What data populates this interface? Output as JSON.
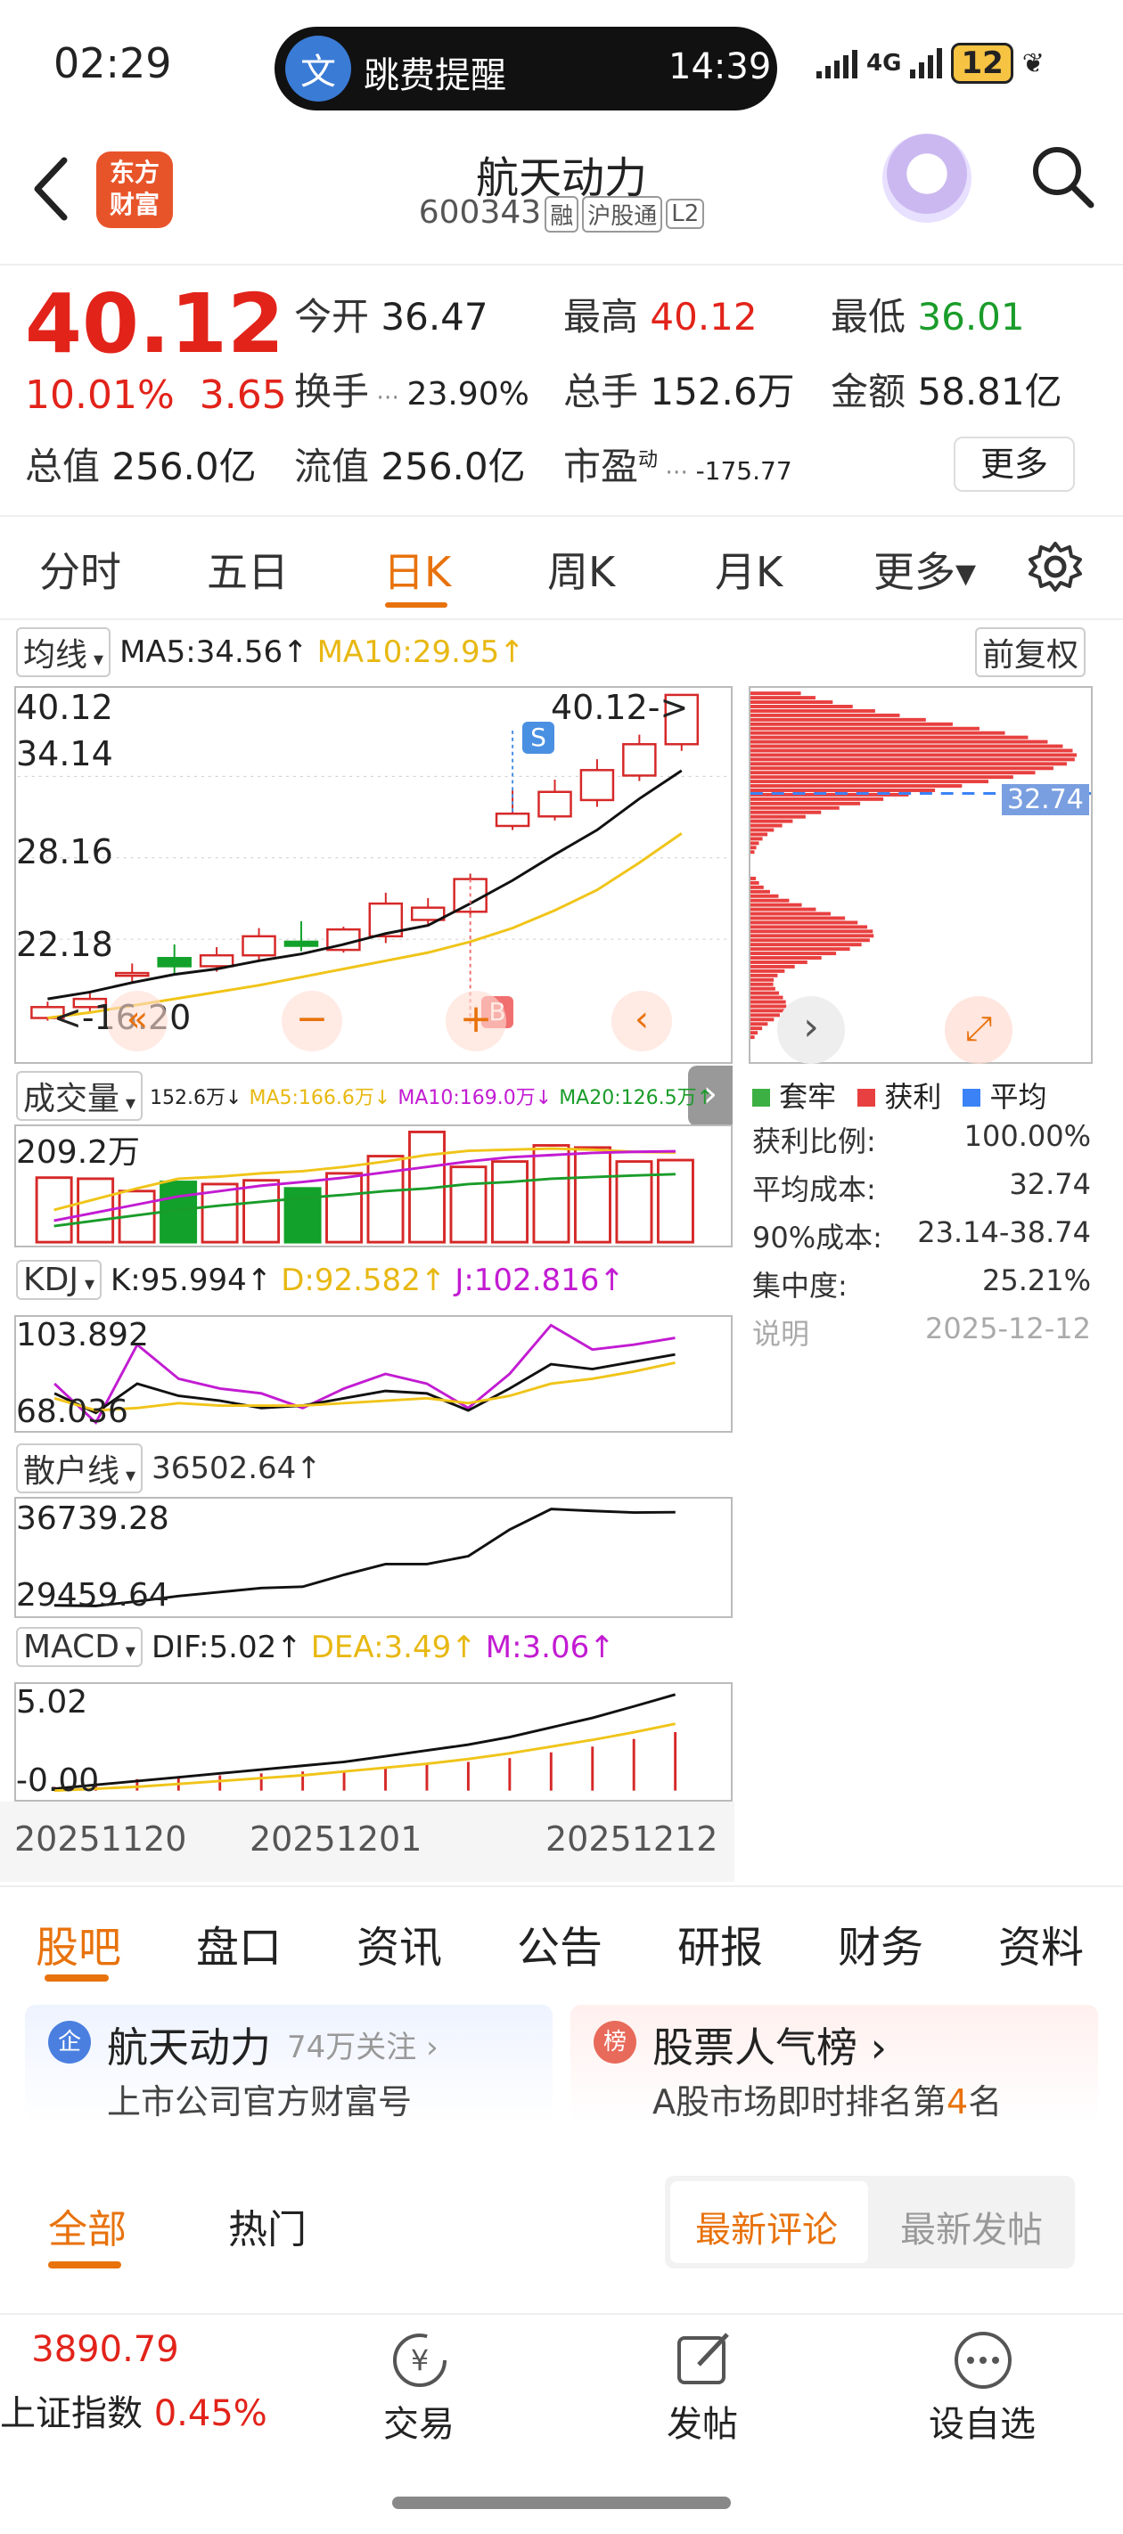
{
  "status": {
    "time": "02:29",
    "notice_icon": "文",
    "notice_text": "跳费提醒",
    "notice_time": "14:39",
    "network": "4G",
    "battery": "12"
  },
  "header": {
    "title": "航天动力",
    "code": "600343",
    "tags": [
      "融",
      "沪股通",
      "L2"
    ],
    "logo_line1": "东方",
    "logo_line2": "财富"
  },
  "quote": {
    "price": "40.12",
    "change_pct": "10.01%",
    "change": "3.65",
    "fields": [
      {
        "label": "今开",
        "value": "36.47",
        "color": "#222"
      },
      {
        "label": "最高",
        "value": "40.12",
        "color": "#e2231a"
      },
      {
        "label": "最低",
        "value": "36.01",
        "color": "#1a9c2a"
      },
      {
        "label": "换手",
        "value": "23.90%",
        "color": "#222"
      },
      {
        "label": "总手",
        "value": "152.6万",
        "color": "#222"
      },
      {
        "label": "金额",
        "value": "58.81亿",
        "color": "#222"
      },
      {
        "label": "总值",
        "value": "256.0亿",
        "color": "#222"
      },
      {
        "label": "流值",
        "value": "256.0亿",
        "color": "#222"
      },
      {
        "label": "市盈",
        "value": "-175.77",
        "color": "#222"
      }
    ],
    "pe_sup": "动",
    "more": "更多"
  },
  "ktabs": [
    "分时",
    "五日",
    "日K",
    "周K",
    "月K",
    "更多▾"
  ],
  "chart": {
    "ma_select": "均线",
    "ma5": "MA5:34.56↑",
    "ma10": "MA10:29.95↑",
    "adjust": "前复权",
    "price_ticks": [
      "40.12",
      "34.14",
      "28.16",
      "22.18",
      "16.20"
    ],
    "high_marker": "40.12->",
    "low_marker": "<-16.20",
    "s_mark": "S",
    "b_mark": "B",
    "vol_select": "成交量",
    "vol_line": "152.6万↓",
    "vol_ma5": "MA5:166.6万↓",
    "vol_ma10": "MA10:169.0万↓",
    "vol_ma20": "MA20:126.5万↑",
    "vol_tick": "209.2万",
    "kdj_select": "KDJ",
    "kdj_k": "K:95.994↑",
    "kdj_d": "D:92.582↑",
    "kdj_j": "J:102.816↑",
    "kdj_ticks": [
      "103.892",
      "68.036"
    ],
    "sh_select": "散户线",
    "sh_val": "36502.64↑",
    "sh_ticks": [
      "36739.28",
      "29459.64"
    ],
    "macd_select": "MACD",
    "dif": "DIF:5.02↑",
    "dea": "DEA:3.49↑",
    "m": "M:3.06↑",
    "macd_ticks": [
      "5.02",
      "-0.00"
    ],
    "dates": [
      "20251120",
      "20251201",
      "20251212"
    ]
  },
  "chart_data": {
    "type": "candlestick",
    "candles": [
      {
        "o": 16.4,
        "c": 17.2,
        "h": 17.6,
        "l": 16.2,
        "up": true
      },
      {
        "o": 17.2,
        "c": 17.8,
        "h": 18.3,
        "l": 16.9,
        "up": true
      },
      {
        "o": 19.5,
        "c": 19.7,
        "h": 20.4,
        "l": 19.0,
        "up": true
      },
      {
        "o": 20.8,
        "c": 20.2,
        "h": 21.8,
        "l": 19.6,
        "up": false
      },
      {
        "o": 20.2,
        "c": 21.0,
        "h": 21.6,
        "l": 19.8,
        "up": true
      },
      {
        "o": 21.0,
        "c": 22.4,
        "h": 23.0,
        "l": 20.6,
        "up": true
      },
      {
        "o": 22.0,
        "c": 21.7,
        "h": 23.5,
        "l": 21.3,
        "up": false
      },
      {
        "o": 21.4,
        "c": 22.9,
        "h": 23.1,
        "l": 21.2,
        "up": true
      },
      {
        "o": 22.4,
        "c": 24.8,
        "h": 25.6,
        "l": 21.9,
        "up": true
      },
      {
        "o": 23.6,
        "c": 24.5,
        "h": 25.2,
        "l": 23.3,
        "up": true
      },
      {
        "o": 24.2,
        "c": 26.6,
        "h": 27.0,
        "l": 23.8,
        "up": true
      },
      {
        "o": 30.5,
        "c": 31.4,
        "h": 33.1,
        "l": 30.2,
        "up": true
      },
      {
        "o": 31.2,
        "c": 33.0,
        "h": 33.9,
        "l": 30.9,
        "up": true
      },
      {
        "o": 32.4,
        "c": 34.6,
        "h": 35.4,
        "l": 31.9,
        "up": true
      },
      {
        "o": 34.2,
        "c": 36.5,
        "h": 37.2,
        "l": 33.8,
        "up": true
      },
      {
        "o": 36.5,
        "c": 40.12,
        "h": 40.12,
        "l": 36.01,
        "up": true
      }
    ],
    "ma5": [
      17.8,
      18.3,
      19.0,
      19.6,
      20.0,
      20.6,
      21.1,
      21.8,
      22.6,
      23.2,
      24.8,
      26.5,
      28.4,
      30.2,
      32.5,
      34.56
    ],
    "ma10": [
      16.4,
      16.8,
      17.3,
      17.8,
      18.3,
      18.8,
      19.4,
      20.0,
      20.6,
      21.2,
      22.0,
      23.0,
      24.3,
      25.8,
      27.8,
      29.95
    ],
    "volumes": [
      120,
      118,
      95,
      112,
      108,
      115,
      100,
      128,
      160,
      205,
      140,
      150,
      180,
      176,
      150,
      152.6
    ],
    "vol_up": [
      true,
      true,
      true,
      false,
      true,
      true,
      false,
      true,
      true,
      true,
      true,
      true,
      true,
      true,
      true,
      true
    ],
    "vol_ma5": [
      60,
      80,
      100,
      118,
      122,
      128,
      132,
      140,
      150,
      162,
      170,
      172,
      174,
      172,
      168,
      166.6
    ],
    "vol_ma10": [
      40,
      55,
      70,
      85,
      95,
      105,
      112,
      120,
      130,
      140,
      150,
      158,
      162,
      166,
      168,
      169.0
    ],
    "vol_ma20": [
      30,
      40,
      50,
      60,
      68,
      75,
      82,
      88,
      95,
      100,
      108,
      112,
      118,
      121,
      124,
      126.5
    ],
    "kdj_k": [
      80,
      72,
      84,
      79,
      77,
      74,
      75,
      78,
      81,
      80,
      73,
      82,
      92,
      90,
      93,
      95.994
    ],
    "kdj_d": [
      78,
      73,
      74,
      76,
      75,
      75,
      75,
      76,
      77,
      78,
      76,
      79,
      84,
      86,
      89,
      92.582
    ],
    "kdj_j": [
      84,
      68,
      100,
      86,
      82,
      80,
      74,
      82,
      88,
      84,
      74,
      88,
      108,
      98,
      100,
      102.816
    ],
    "sh": [
      29500,
      29459.64,
      29800,
      30200,
      30500,
      30800,
      30900,
      31800,
      32600,
      32600,
      33200,
      35200,
      36739.28,
      36600,
      36480,
      36502.64
    ],
    "dif": [
      0.1,
      0.3,
      0.5,
      0.7,
      0.9,
      1.1,
      1.3,
      1.5,
      1.8,
      2.1,
      2.4,
      2.8,
      3.3,
      3.8,
      4.4,
      5.02
    ],
    "dea": [
      0.0,
      0.1,
      0.2,
      0.35,
      0.5,
      0.65,
      0.8,
      1.0,
      1.2,
      1.4,
      1.65,
      1.95,
      2.3,
      2.65,
      3.05,
      3.49
    ],
    "m": [
      0.2,
      0.4,
      0.6,
      0.7,
      0.8,
      0.9,
      1.0,
      1.0,
      1.2,
      1.4,
      1.5,
      1.7,
      2.0,
      2.3,
      2.7,
      3.06
    ],
    "price_range": [
      14.2,
      40.12
    ]
  },
  "chip": {
    "avg_label": "32.74",
    "legend": [
      {
        "label": "套牢",
        "color": "#3cb043"
      },
      {
        "label": "获利",
        "color": "#e84040"
      },
      {
        "label": "平均",
        "color": "#3b82f6"
      }
    ],
    "rows": [
      {
        "k": "获利比例:",
        "v": "100.00%"
      },
      {
        "k": "平均成本:",
        "v": "32.74"
      },
      {
        "k": "90%成本:",
        "v": "23.14-38.74"
      },
      {
        "k": "集中度:",
        "v": "25.21%"
      },
      {
        "k": "说明",
        "v": "2025-12-12"
      }
    ]
  },
  "btabs": [
    "股吧",
    "盘口",
    "资讯",
    "公告",
    "研报",
    "财务",
    "资料"
  ],
  "cards": [
    {
      "badge": "企",
      "title": "航天动力",
      "meta": "74万关注 ›",
      "sub": "上市公司官方财富号"
    },
    {
      "badge": "榜",
      "title": "股票人气榜 ›",
      "meta": "",
      "sub_pre": "A股市场即时排名第",
      "sub_num": "4",
      "sub_post": "名"
    }
  ],
  "filters": {
    "all": "全部",
    "hot": "热门",
    "latest_comment": "最新评论",
    "latest_post": "最新发帖"
  },
  "nav": {
    "index_value": "3890.79",
    "index_name": "上证指数",
    "index_chg": "0.45%",
    "trade": "交易",
    "post": "发帖",
    "watch": "设自选"
  }
}
